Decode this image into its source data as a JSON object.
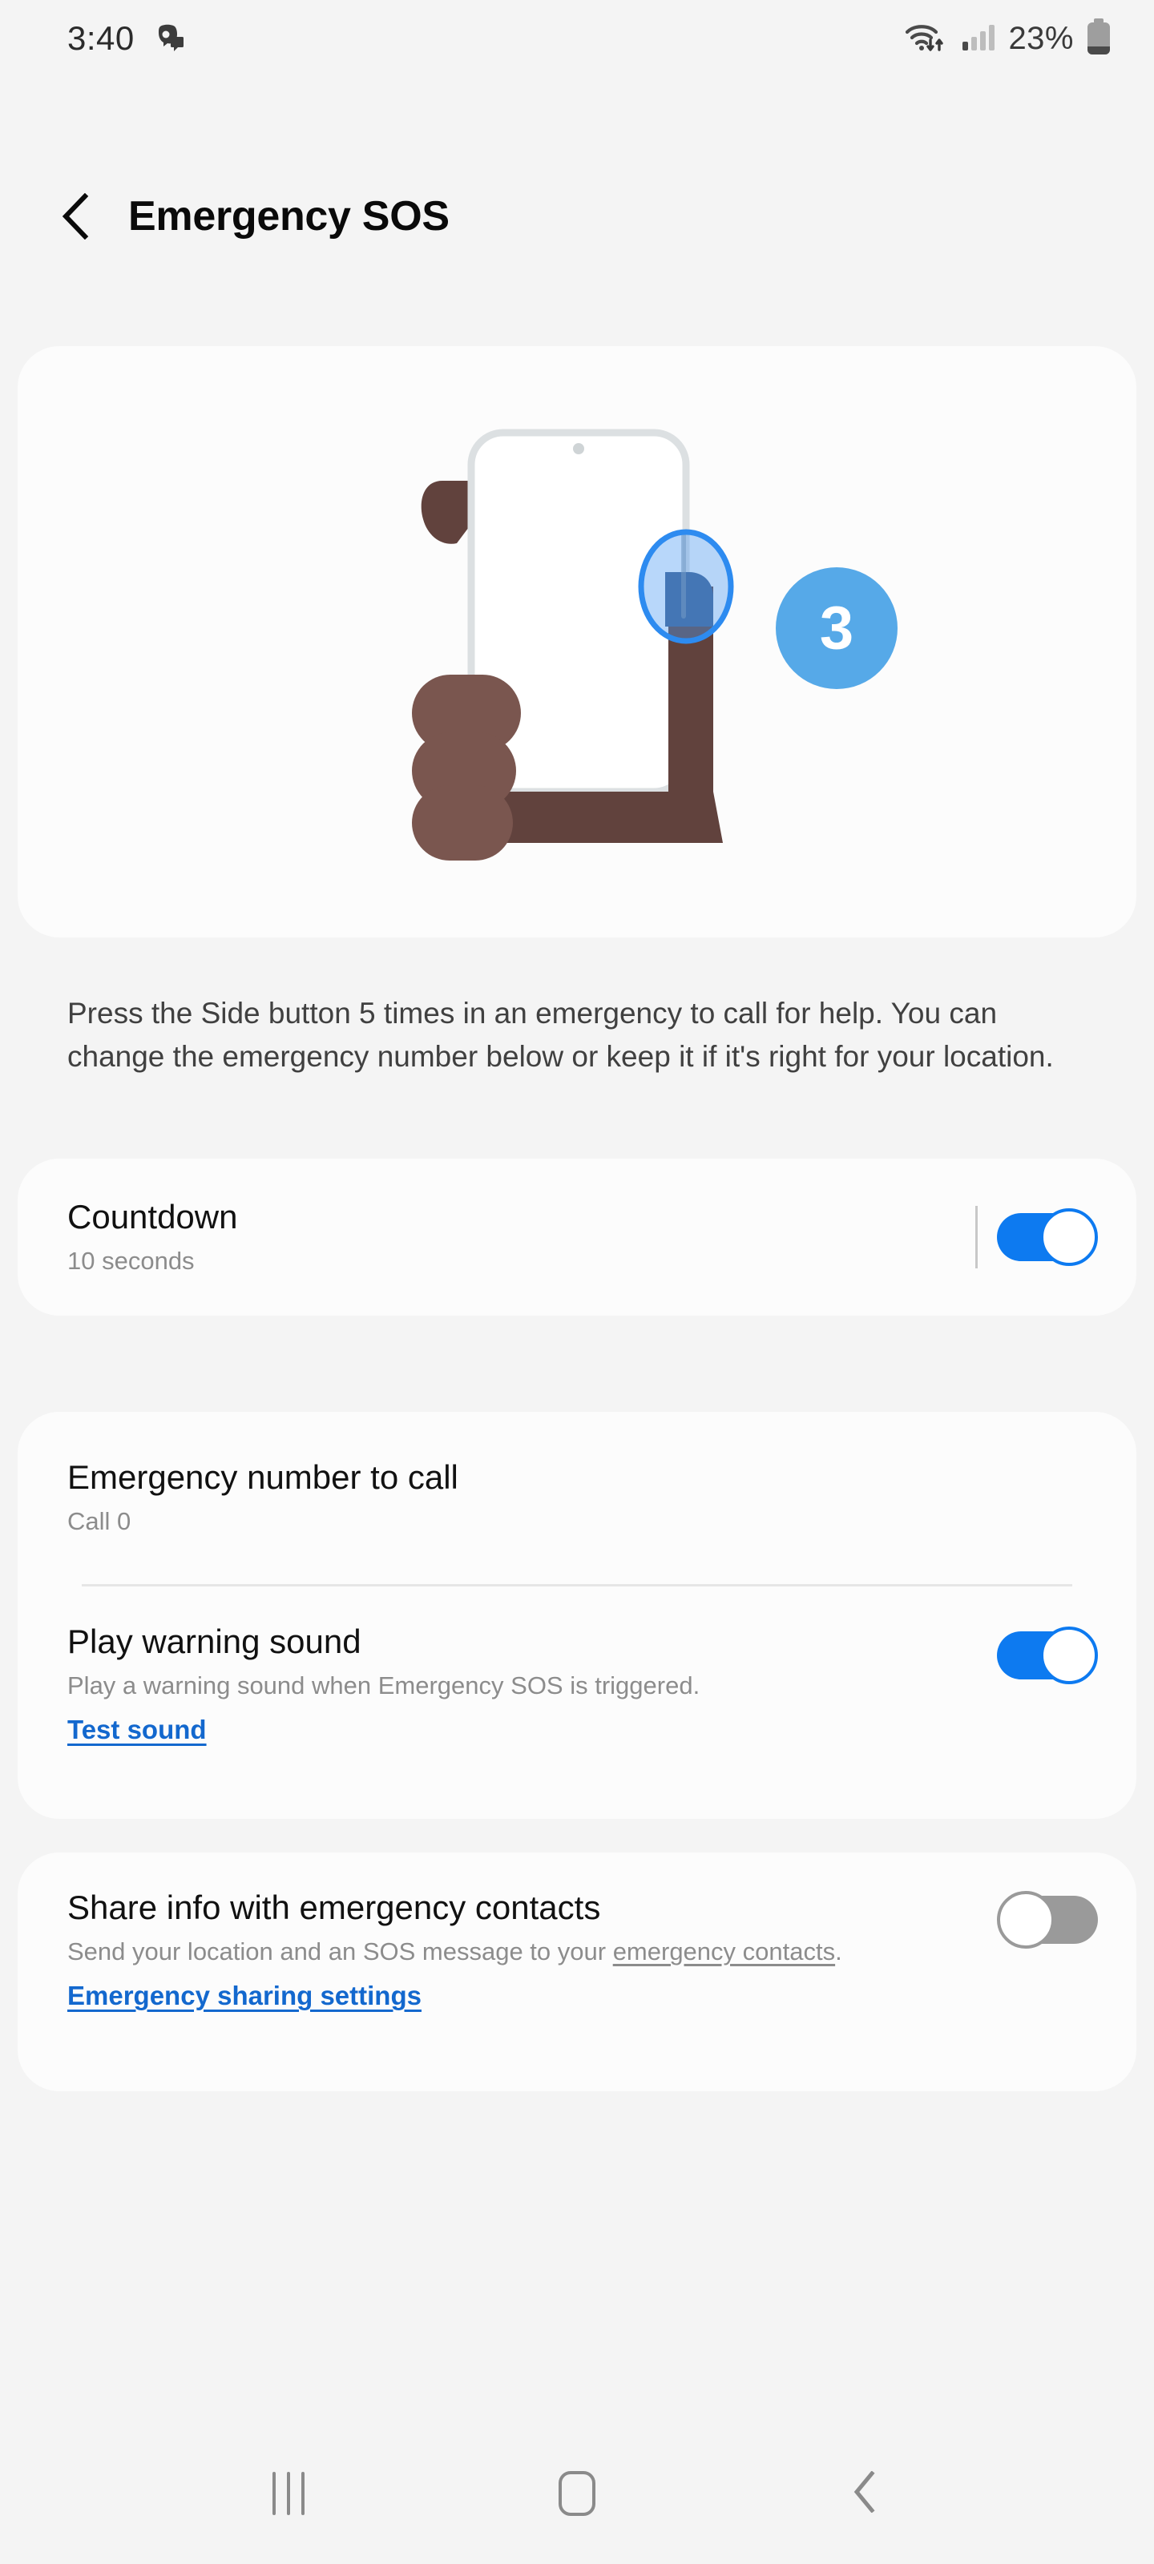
{
  "status_bar": {
    "time": "3:40",
    "notification_icon": "discord-notification-icon",
    "wifi_icon": "wifi-with-data-transfer-icon",
    "signal_icon": "cellular-signal-icon",
    "battery_percent": "23%",
    "battery_icon": "battery-low-icon"
  },
  "header": {
    "back_icon": "back-chevron-icon",
    "title": "Emergency SOS"
  },
  "illustration": {
    "name": "hand-pressing-side-button-illustration",
    "counter_badge": "3",
    "badge_color": "#56A9E8",
    "touch_highlight_color": "#3F9BF5",
    "skin_color": "#6E4B45",
    "phone_outline_color": "#DCE0E2"
  },
  "description": "Press the Side button 5 times in an emergency to call for help. You can change the emergency number below or keep it if it's right for your location.",
  "countdown": {
    "title": "Countdown",
    "subtitle": "10 seconds",
    "toggle_state": "on"
  },
  "emergency_number": {
    "title": "Emergency number to call",
    "subtitle": "Call 0"
  },
  "warning_sound": {
    "title": "Play warning sound",
    "subtitle": "Play a warning sound when Emergency SOS is triggered.",
    "link": "Test sound",
    "toggle_state": "on"
  },
  "share_info": {
    "title": "Share info with emergency contacts",
    "subtitle_before": "Send your location and an SOS message to your ",
    "subtitle_link": "emergency contacts",
    "subtitle_after": ".",
    "link": "Emergency sharing settings",
    "toggle_state": "off"
  },
  "nav_bar": {
    "recents_label": "recents-button",
    "home_label": "home-button",
    "back_label": "back-button"
  },
  "colors": {
    "accent_blue": "#0D7AF0",
    "link_blue": "#1368CE",
    "page_bg": "#F4F4F4",
    "card_bg": "#FCFCFC",
    "toggle_off": "#9A9A9A"
  }
}
